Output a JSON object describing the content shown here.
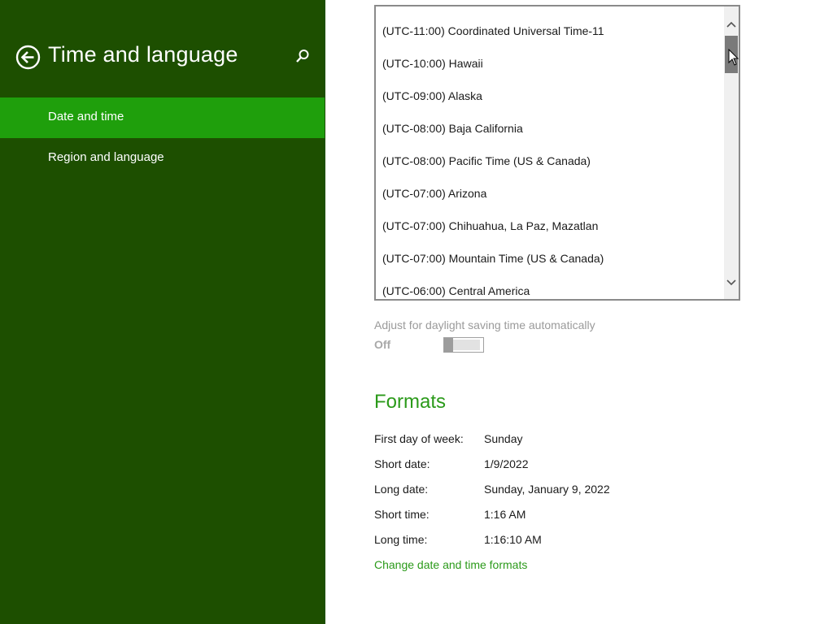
{
  "sidebar": {
    "title": "Time and language",
    "back_icon": "back-arrow-icon",
    "search_icon": "search-icon",
    "items": [
      {
        "label": "Date and time",
        "selected": true
      },
      {
        "label": "Region and language",
        "selected": false
      }
    ],
    "bg_color": "#1d4f00",
    "selected_color": "#1f9f0c"
  },
  "timezone_list": {
    "items": [
      "(UTC-11:00) Coordinated Universal Time-11",
      "(UTC-10:00) Hawaii",
      "(UTC-09:00) Alaska",
      "(UTC-08:00) Baja California",
      "(UTC-08:00) Pacific Time (US & Canada)",
      "(UTC-07:00) Arizona",
      "(UTC-07:00) Chihuahua, La Paz, Mazatlan",
      "(UTC-07:00) Mountain Time (US & Canada)",
      "(UTC-06:00) Central America"
    ]
  },
  "daylight": {
    "label": "Adjust for daylight saving time automatically",
    "state": "Off"
  },
  "formats": {
    "title": "Formats",
    "rows": [
      {
        "label": "First day of week:",
        "value": "Sunday"
      },
      {
        "label": "Short date:",
        "value": "1/9/2022"
      },
      {
        "label": "Long date:",
        "value": "Sunday, January 9, 2022"
      },
      {
        "label": "Short time:",
        "value": "1:16 AM"
      },
      {
        "label": "Long time:",
        "value": "1:16:10 AM"
      }
    ],
    "change_link": "Change date and time formats"
  },
  "accent_color": "#2b9a1a"
}
